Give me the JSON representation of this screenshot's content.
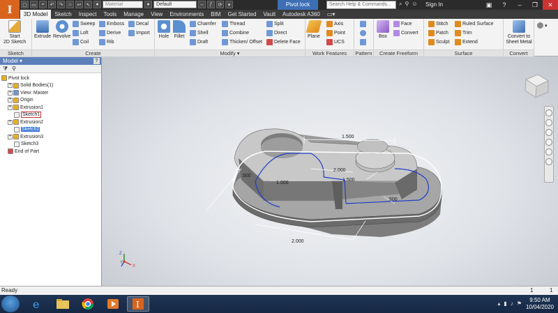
{
  "app": {
    "logo_letter": "I",
    "document_title": "Pivot lock",
    "material_combo": "Material",
    "appearance_combo": "Default",
    "search_placeholder": "Search Help & Commands...",
    "sign_in": "Sign In"
  },
  "tabs": [
    "3D Model",
    "Sketch",
    "Inspect",
    "Tools",
    "Manage",
    "View",
    "Environments",
    "BIM",
    "Get Started",
    "Vault",
    "Autodesk A360"
  ],
  "ribbon": {
    "sketch_panel": {
      "title": "Sketch",
      "start_sketch": "Start",
      "start_sketch_2": "2D Sketch"
    },
    "create_panel": {
      "title": "Create",
      "extrude": "Extrude",
      "revolve": "Revolve",
      "sweep": "Sweep",
      "loft": "Loft",
      "coil": "Coil",
      "emboss": "Emboss",
      "derive": "Derive",
      "rib": "Rib",
      "decal": "Decal",
      "import": "Import"
    },
    "modify_panel": {
      "title": "Modify",
      "hole": "Hole",
      "fillet": "Fillet",
      "chamfer": "Chamfer",
      "shell": "Shell",
      "draft": "Draft",
      "thread": "Thread",
      "combine": "Combine",
      "thicken": "Thicken/ Offset",
      "split": "Split",
      "direct": "Direct",
      "delete_face": "Delete Face"
    },
    "work_panel": {
      "title": "Work Features",
      "plane": "Plane",
      "axis": "Axis",
      "point": "Point",
      "ucs": "UCS"
    },
    "pattern_panel": {
      "title": "Pattern"
    },
    "freeform_panel": {
      "title": "Create Freeform",
      "box": "Box",
      "face": "Face",
      "convert": "Convert"
    },
    "surface_panel": {
      "title": "Surface",
      "stitch": "Stitch",
      "patch": "Patch",
      "sculpt": "Sculpt",
      "ruled": "Ruled Surface",
      "trim": "Trim",
      "extend": "Extend"
    },
    "convert_panel": {
      "title": "Convert",
      "sheet_metal": "Convert to",
      "sheet_metal_2": "Sheet Metal"
    }
  },
  "browser": {
    "title": "Model",
    "tree": [
      {
        "label": "Pivot lock",
        "level": 0
      },
      {
        "label": "Solid Bodies(1)",
        "level": 1
      },
      {
        "label": "View: Master",
        "level": 1
      },
      {
        "label": "Origin",
        "level": 1
      },
      {
        "label": "Extrusion1",
        "level": 1
      },
      {
        "label": "Sketch1",
        "level": 2
      },
      {
        "label": "Extrusion2",
        "level": 1
      },
      {
        "label": "Sketch2",
        "level": 2
      },
      {
        "label": "Extrusion3",
        "level": 1
      },
      {
        "label": "Sketch3",
        "level": 2
      },
      {
        "label": "End of Part",
        "level": 1
      }
    ]
  },
  "viewport": {
    "dimensions": {
      "d1": "1.500",
      "d2": "2.000",
      "d3": "1.500",
      "d4": "1.000",
      "d5": ".500",
      "d6": "2.000",
      "d7": ".500"
    },
    "triad": {
      "x": "X",
      "y": "Y",
      "z": "Z"
    }
  },
  "status": {
    "ready": "Ready",
    "count1": "1",
    "count2": "1"
  },
  "taskbar": {
    "time": "9:50 AM",
    "date": "10/04/2020"
  },
  "colors": {
    "accent": "#d8641e",
    "selection": "#3875d7",
    "sketch_line": "#1f3fc7"
  }
}
